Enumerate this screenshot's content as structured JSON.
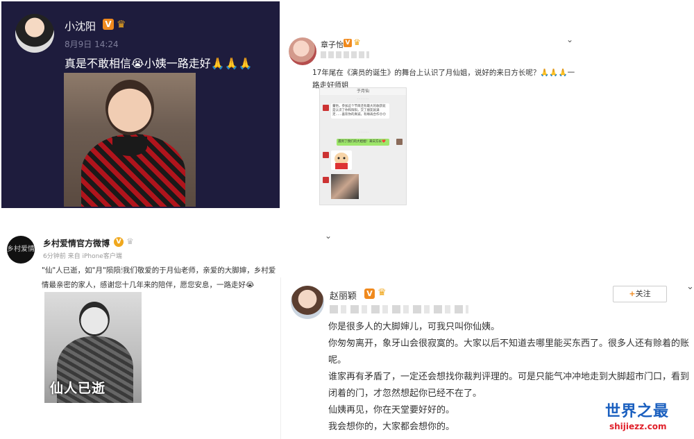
{
  "post1": {
    "username": "小沈阳",
    "verified_badge": "V",
    "timestamp": "8月9日 14:24",
    "text": "真是不敢相信😭小姨一路走好🙏🙏🙏"
  },
  "post2": {
    "username": "章子怡",
    "verified_badge": "V",
    "text": "17年尾在《演员的诞生》的舞台上认识了月仙姐，说好的来日方长呢？🙏🙏🙏一路走好师姐",
    "chat": {
      "header": "于月仙",
      "message1": "董怡，参加这个节目还有最大的收获就是认识了你和阳阳，交了朋友就满足……喜欢你的真诚，有缘再合作😊😊",
      "message2": "遇到了我们的大姐姐！来日方长❤️"
    }
  },
  "post3": {
    "avatar_text": "乡村爱情",
    "username": "乡村爱情官方微博",
    "verified_badge": "V",
    "meta": "6分钟前 来自 iPhone客户端",
    "text": "\"仙\"人已逝，如\"月\"陨陨🕯我们敬爱的于月仙老师，亲爱的大脚婶，乡村爱情最亲密的家人，感谢您十几年来的陪伴，愿您安息，一路走好😭",
    "photo_overlay": "仙人已逝"
  },
  "post4": {
    "username": "赵丽颖",
    "verified_badge": "V",
    "follow_label": "关注",
    "lines": [
      "你是很多人的大脚婶儿，可我只叫你仙姨。",
      "你匆匆离开，象牙山会很寂寞的。大家以后不知道去哪里能买东西了。很多人还有赊着的账呢。",
      "谁家再有矛盾了，一定还会想找你裁判评理的。可是只能气冲冲地走到大脚超市门口，看到闭着的门，才忽然想起你已经不在了。",
      "仙姨再见，你在天堂要好好的。",
      "我会想你的，大家都会想你的。"
    ]
  },
  "watermark": {
    "title": "世界之最",
    "url": "shijiezz.com"
  },
  "colors": {
    "dark_bg": "#1e1c3d",
    "verified_orange": "#f08a1e",
    "watermark_blue": "#1a5fbf",
    "watermark_red": "#e0202a"
  }
}
